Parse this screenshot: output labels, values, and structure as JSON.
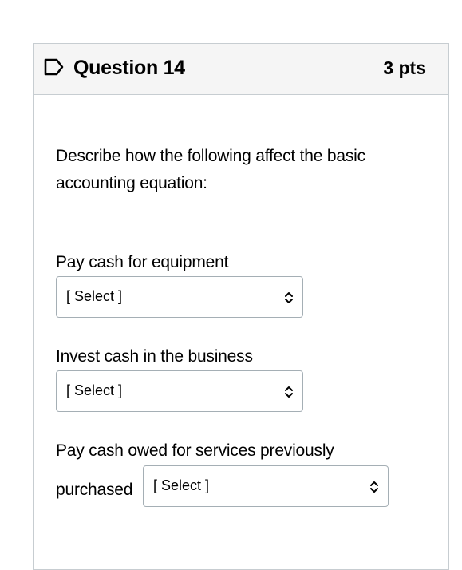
{
  "question": {
    "title": "Question 14",
    "points": "3 pts",
    "prompt": "Describe how the following affect the basic accounting equation:",
    "items": [
      {
        "label": "Pay cash for equipment",
        "selected": "[ Select ]"
      },
      {
        "label": "Invest cash in the business",
        "selected": "[ Select ]"
      },
      {
        "label_line1": "Pay cash owed for services previously",
        "label_line2": "purchased",
        "selected": "[ Select ]"
      }
    ]
  }
}
